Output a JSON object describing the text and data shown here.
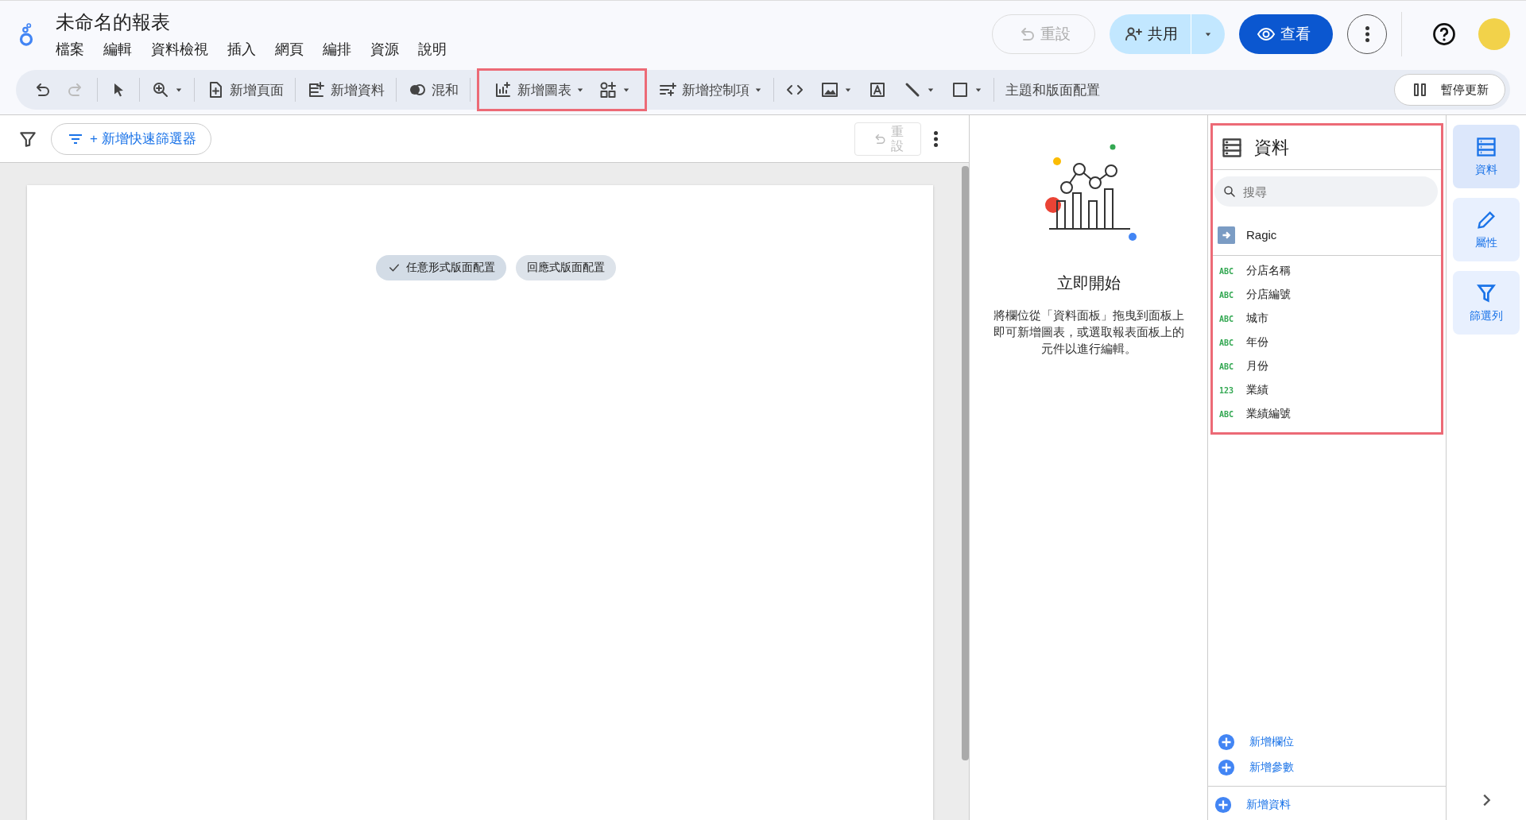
{
  "header": {
    "title": "未命名的報表",
    "menu": [
      "檔案",
      "編輯",
      "資料檢視",
      "插入",
      "網頁",
      "編排",
      "資源",
      "說明"
    ],
    "reset": {
      "label": "重設",
      "disabled": true
    },
    "share": {
      "label": "共用"
    },
    "view": {
      "label": "查看"
    }
  },
  "toolbar": {
    "items": [
      {
        "kind": "icon",
        "disabled": false
      },
      {
        "kind": "icon",
        "disabled": true
      },
      {
        "kind": "divider"
      },
      {
        "kind": "icon",
        "disabled": false
      },
      {
        "kind": "divider"
      },
      {
        "kind": "icon",
        "caret": true,
        "disabled": false
      },
      {
        "kind": "divider"
      },
      {
        "kind": "text",
        "label": "新增頁面"
      },
      {
        "kind": "divider"
      },
      {
        "kind": "text",
        "label": "新增資料"
      },
      {
        "kind": "divider"
      },
      {
        "kind": "text",
        "label": "混和"
      },
      {
        "kind": "divider"
      },
      {
        "kind": "group",
        "highlighted": true,
        "items": [
          {
            "kind": "text",
            "label": "新增圖表",
            "caret": true
          },
          {
            "kind": "icon",
            "caret": true,
            "disabled": false
          }
        ]
      },
      {
        "kind": "text",
        "label": "新增控制項",
        "caret": true
      },
      {
        "kind": "divider"
      },
      {
        "kind": "icon",
        "disabled": false
      },
      {
        "kind": "icon",
        "caret": true,
        "disabled": false
      },
      {
        "kind": "icon",
        "disabled": false
      },
      {
        "kind": "icon",
        "caret": true,
        "disabled": false
      },
      {
        "kind": "icon",
        "caret": true,
        "disabled": false
      },
      {
        "kind": "divider"
      },
      {
        "kind": "text",
        "label": "主題和版面配置"
      }
    ],
    "pause": {
      "label": "暫停更新"
    }
  },
  "filter_bar": {
    "add_filter": "+ 新增快速篩選器",
    "reset": {
      "label": "重設",
      "disabled": true
    }
  },
  "canvas": {
    "layout_options": [
      {
        "label": "任意形式版面配置",
        "selected": true
      },
      {
        "label": "回應式版面配置",
        "selected": false
      }
    ]
  },
  "intro": {
    "title": "立即開始",
    "text": "將欄位從「資料面板」拖曳到面板上即可新增圖表，或選取報表面板上的元件以進行編輯。"
  },
  "data_panel": {
    "title": "資料",
    "highlighted": true,
    "search": {
      "placeholder": "搜尋"
    },
    "source": "Ragic",
    "fields": [
      {
        "type": "ABC",
        "name": "分店名稱"
      },
      {
        "type": "ABC",
        "name": "分店編號"
      },
      {
        "type": "ABC",
        "name": "城市"
      },
      {
        "type": "ABC",
        "name": "年份"
      },
      {
        "type": "ABC",
        "name": "月份"
      },
      {
        "type": "123",
        "name": "業績"
      },
      {
        "type": "ABC",
        "name": "業績編號"
      }
    ],
    "actions": [
      "新增欄位",
      "新增參數"
    ],
    "add_data": "新增資料"
  },
  "rail": [
    {
      "label": "資料",
      "selected": true
    },
    {
      "label": "屬性",
      "selected": false
    },
    {
      "label": "篩選列",
      "selected": false
    }
  ]
}
